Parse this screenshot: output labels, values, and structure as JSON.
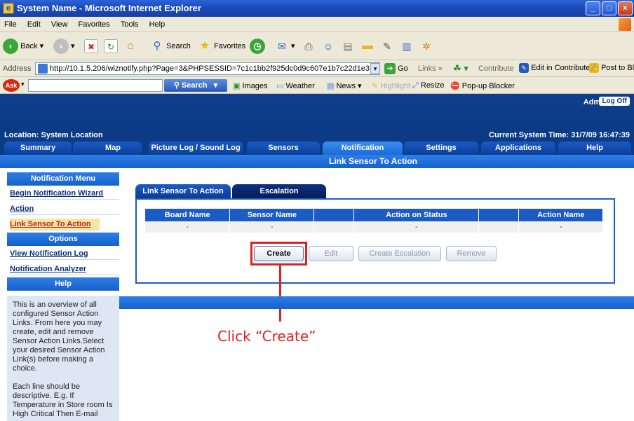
{
  "window": {
    "title": "System Name - Microsoft Internet Explorer"
  },
  "menu": [
    "File",
    "Edit",
    "View",
    "Favorites",
    "Tools",
    "Help"
  ],
  "toolbar": {
    "back": "Back",
    "search": "Search",
    "favorites": "Favorites"
  },
  "address": {
    "label": "Address",
    "url": "http://10.1.5.206/wiznotify.php?Page=3&PHPSESSID=7c1c1bb2f925dc0d9c607e1b7c22d1e3",
    "go": "Go",
    "links": "Links",
    "contribute": "Contribute",
    "edit_in_contribute": "Edit in Contribute",
    "post_to_blog": "Post to Blo"
  },
  "searchbar": {
    "search": "Search",
    "images": "Images",
    "weather": "Weather",
    "news": "News",
    "highlight": "Highlight",
    "resize": "Resize",
    "popup_blocker": "Pop-up Blocker"
  },
  "header": {
    "admin": "Admin",
    "logoff": "Log Off",
    "location": "Location: System Location",
    "system_time": "Current System Time: 31/7/09 16:47:39"
  },
  "nav": {
    "tabs": [
      "Summary",
      "Map",
      "Picture Log / Sound Log",
      "Sensors",
      "Notification",
      "Settings",
      "Applications",
      "Help"
    ],
    "active": "Notification",
    "subtitle": "Link Sensor To Action"
  },
  "sidebar": {
    "notification_menu": "Notification Menu",
    "begin_wizard": "Begin Notification Wizard",
    "action": "Action",
    "link_sensor": "Link Sensor To Action",
    "options": "Options",
    "view_log": "View Notification Log",
    "analyzer": "Notification Analyzer",
    "help": "Help",
    "help_text_1": "This is an overview of all configured Sensor Action Links. From here you may create, edit and remove Sensor Action Links.Select your desired Sensor Action Link(s) before making a choice.",
    "help_text_2": "Each line should be descriptive. E.g. If Temperature in Store room Is High Critical Then E-mail"
  },
  "content": {
    "tab_link": "Link Sensor To Action",
    "tab_escalation": "Escalation",
    "columns": [
      "Board Name",
      "Sensor Name",
      "",
      "Action on Status",
      "",
      "Action Name"
    ],
    "row": [
      "-",
      "-",
      "",
      "-",
      "",
      "-"
    ],
    "buttons": {
      "create": "Create",
      "edit": "Edit",
      "create_escalation": "Create Escalation",
      "remove": "Remove"
    }
  },
  "annotation": {
    "callout": "Click “Create”",
    "color": "#e02020"
  }
}
